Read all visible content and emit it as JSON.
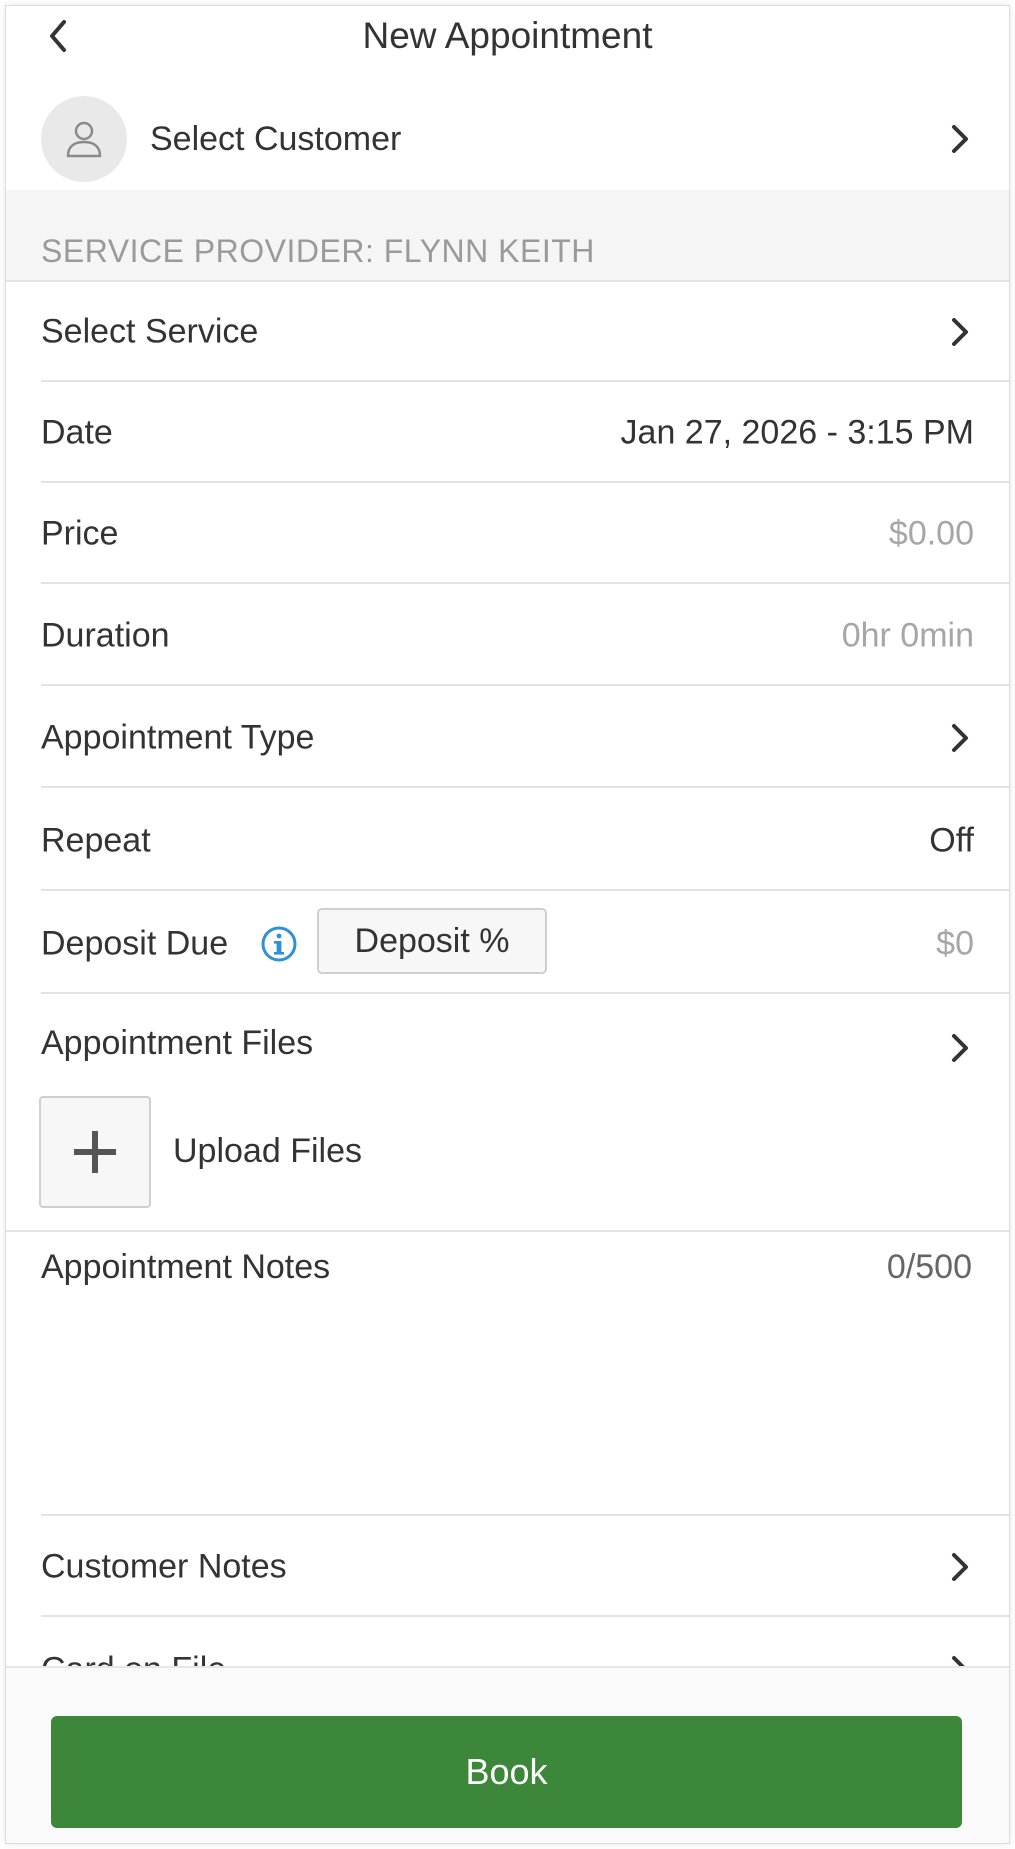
{
  "header": {
    "title": "New Appointment",
    "back_icon": "chevron-left-icon"
  },
  "customer": {
    "label": "Select Customer",
    "avatar_icon": "person-icon"
  },
  "section": {
    "provider_label": "SERVICE PROVIDER: FLYNN KEITH"
  },
  "rows": {
    "service": {
      "label": "Select Service"
    },
    "date": {
      "label": "Date",
      "value": "Jan 27, 2026 - 3:15 PM"
    },
    "price": {
      "label": "Price",
      "value": "$0.00"
    },
    "duration": {
      "label": "Duration",
      "value": "0hr 0min"
    },
    "appointment_type": {
      "label": "Appointment Type"
    },
    "repeat": {
      "label": "Repeat",
      "value": "Off"
    },
    "deposit": {
      "label": "Deposit Due",
      "button": "Deposit %",
      "value": "$0"
    }
  },
  "files": {
    "title": "Appointment Files",
    "upload_label": "Upload Files"
  },
  "notes": {
    "title": "Appointment Notes",
    "count": "0/500"
  },
  "more_rows": {
    "customer_notes": {
      "label": "Customer Notes"
    },
    "card_on_file": {
      "label": "Card on File"
    }
  },
  "footer": {
    "book_label": "Book"
  },
  "colors": {
    "accent_green": "#3c873a",
    "info_blue": "#2f8fd8",
    "muted_text": "#a6a6a6",
    "divider": "#e3e3e3"
  }
}
